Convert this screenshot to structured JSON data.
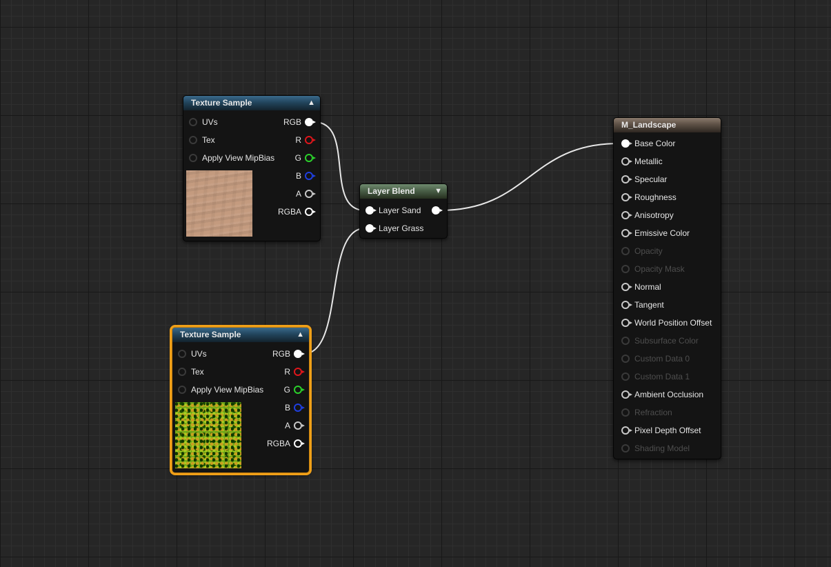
{
  "nodes": {
    "texture_sample_1": {
      "title": "Texture Sample",
      "inputs": [
        "UVs",
        "Tex",
        "Apply View MipBias"
      ],
      "outputs": [
        "RGB",
        "R",
        "G",
        "B",
        "A",
        "RGBA"
      ]
    },
    "texture_sample_2": {
      "title": "Texture Sample",
      "inputs": [
        "UVs",
        "Tex",
        "Apply View MipBias"
      ],
      "outputs": [
        "RGB",
        "R",
        "G",
        "B",
        "A",
        "RGBA"
      ]
    },
    "layer_blend": {
      "title": "Layer Blend",
      "inputs": [
        "Layer Sand",
        "Layer Grass"
      ]
    },
    "material": {
      "title": "M_Landscape",
      "inputs": [
        "Base Color",
        "Metallic",
        "Specular",
        "Roughness",
        "Anisotropy",
        "Emissive Color",
        "Opacity",
        "Opacity Mask",
        "Normal",
        "Tangent",
        "World Position Offset",
        "Subsurface Color",
        "Custom Data 0",
        "Custom Data 1",
        "Ambient Occlusion",
        "Refraction",
        "Pixel Depth Offset",
        "Shading Model"
      ],
      "disabled_inputs": [
        "Opacity",
        "Opacity Mask",
        "Subsurface Color",
        "Custom Data 0",
        "Custom Data 1",
        "Refraction",
        "Shading Model"
      ]
    }
  },
  "colors": {
    "pin_white": "#ffffff",
    "pin_r": "#e0161b",
    "pin_g": "#2bd12b",
    "pin_b": "#1f3fe0",
    "pin_a": "#c8c8c8",
    "selection": "#f0a018",
    "wire": "#e8e8e8"
  },
  "icons": {
    "collapse": "chevron-up-icon",
    "expand": "chevron-down-icon"
  }
}
